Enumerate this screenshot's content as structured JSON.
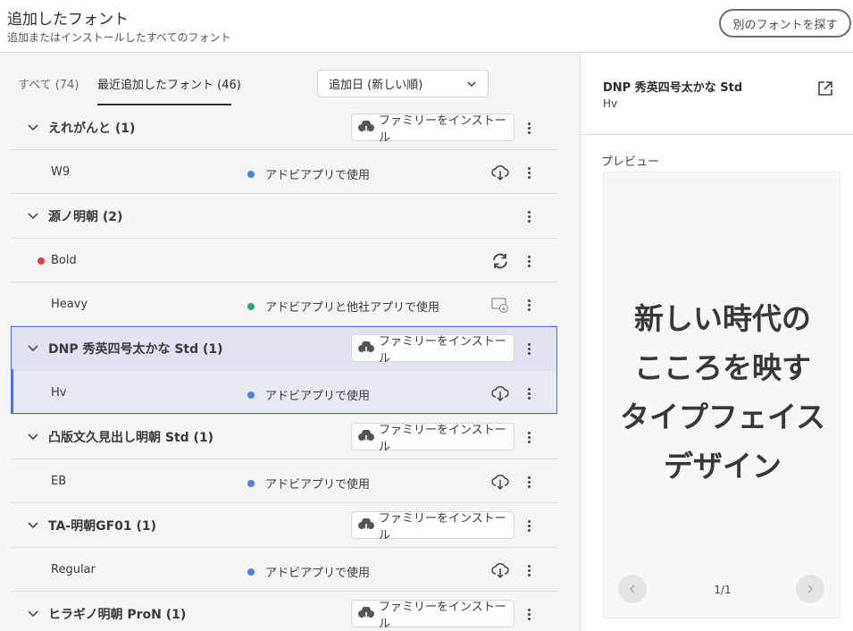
{
  "header": {
    "title": "追加したフォント",
    "subtitle": "追加またはインストールしたすべてのフォント",
    "find_button": "別のフォントを探す"
  },
  "tabs": [
    {
      "label": "すべて (74)",
      "active": false
    },
    {
      "label": "最近追加したフォント (46)",
      "active": true
    }
  ],
  "sort": {
    "selected": "追加日 (新しい順)"
  },
  "install_label": "ファミリーをインストール",
  "families": [
    {
      "name": "えれがんと (1)",
      "installable": true,
      "styles": [
        {
          "name": "W9",
          "status": "アドビアプリで使用",
          "status_color": "#4a82e0",
          "action": "cloud-download-icon"
        }
      ]
    },
    {
      "name": "源ノ明朝 (2)",
      "installable": false,
      "styles": [
        {
          "name": "Bold",
          "status": "",
          "left_dot_color": "#d94141",
          "action": "sync-icon"
        },
        {
          "name": "Heavy",
          "status": "アドビアプリと他社アプリで使用",
          "status_color": "#2fa37a",
          "action": "desktop-install-icon"
        }
      ]
    },
    {
      "name": "DNP 秀英四号太かな Std (1)",
      "installable": true,
      "selected": true,
      "styles": [
        {
          "name": "Hv",
          "status": "アドビアプリで使用",
          "status_color": "#4a82e0",
          "action": "cloud-download-icon"
        }
      ]
    },
    {
      "name": "凸版文久見出し明朝 Std (1)",
      "installable": true,
      "styles": [
        {
          "name": "EB",
          "status": "アドビアプリで使用",
          "status_color": "#4a82e0",
          "action": "cloud-download-icon"
        }
      ]
    },
    {
      "name": "TA-明朝GF01 (1)",
      "installable": true,
      "styles": [
        {
          "name": "Regular",
          "status": "アドビアプリで使用",
          "status_color": "#4a82e0",
          "action": "cloud-download-icon"
        }
      ]
    },
    {
      "name": "ヒラギノ明朝 ProN (1)",
      "installable": true,
      "styles": []
    }
  ],
  "detail": {
    "font_name": "DNP 秀英四号太かな Std",
    "font_style": "Hv",
    "preview_label": "プレビュー",
    "preview_lines": [
      "新しい時代の",
      "こころを映す",
      "タイプフェイス",
      "デザイン"
    ],
    "pager": "1/1"
  }
}
